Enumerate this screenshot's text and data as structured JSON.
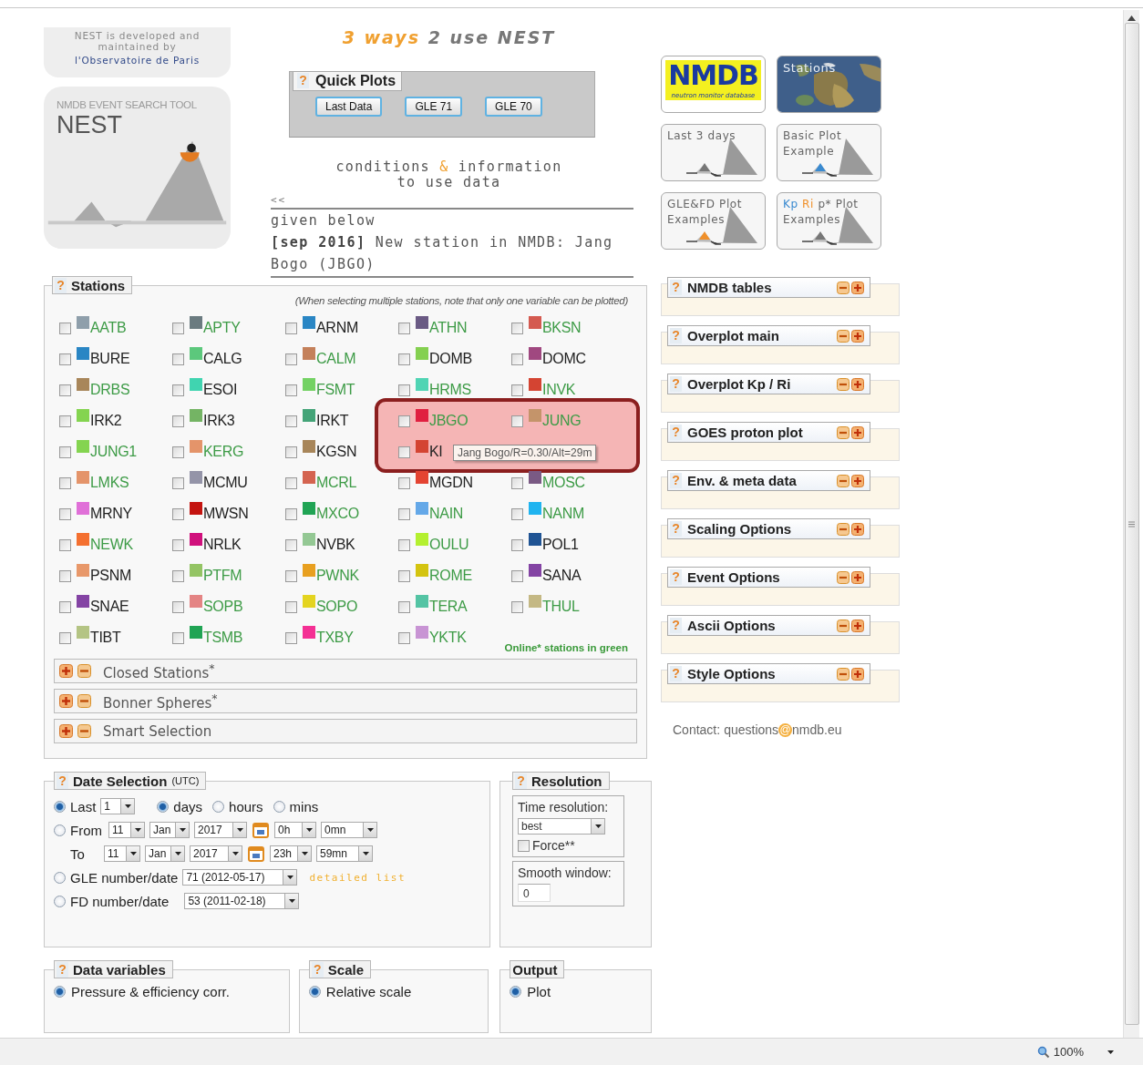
{
  "logo_card": {
    "credit_line": "NEST is developed and maintained by",
    "credit_link": "l'Observatoire de Paris",
    "subtitle": "NMDB EVENT SEARCH TOOL",
    "title": "NEST"
  },
  "headline": {
    "part_1": "3 ways",
    "part_2": "2 use NEST"
  },
  "quick_plots": {
    "help": "?",
    "title": "Quick Plots",
    "buttons": [
      "Last Data",
      "GLE 71",
      "GLE 70"
    ]
  },
  "conditions": {
    "word_1": "conditions",
    "amp": "&",
    "word_2": "information",
    "line_2": "to use data"
  },
  "news": {
    "marker": "<<",
    "lines": [
      "given below",
      "**[sep 2016]** New station in NMDB: Jang Bogo (JBGO)"
    ]
  },
  "stations": {
    "help": "?",
    "title": "Stations",
    "note": "(When selecting multiple stations, note that only one variable can be plotted)",
    "rows": [
      [
        {
          "code": "AATB",
          "color": "#8f9fab",
          "online": true,
          "checked": false
        },
        {
          "code": "APTY",
          "color": "#6b7b80",
          "online": true,
          "checked": false
        },
        {
          "code": "ARNM",
          "color": "#2a86c4",
          "online": false,
          "checked": false
        },
        {
          "code": "ATHN",
          "color": "#6a5a84",
          "online": true,
          "checked": false
        },
        {
          "code": "BKSN",
          "color": "#d45a50",
          "online": true,
          "checked": false
        }
      ],
      [
        {
          "code": "BURE",
          "color": "#2a86c4",
          "online": false,
          "checked": false
        },
        {
          "code": "CALG",
          "color": "#5cc87c",
          "online": false,
          "checked": false
        },
        {
          "code": "CALM",
          "color": "#c4805a",
          "online": true,
          "checked": false
        },
        {
          "code": "DOMB",
          "color": "#84d050",
          "online": false,
          "checked": false
        },
        {
          "code": "DOMC",
          "color": "#a04880",
          "online": false,
          "checked": false
        }
      ],
      [
        {
          "code": "DRBS",
          "color": "#a8865a",
          "online": true,
          "checked": false
        },
        {
          "code": "ESOI",
          "color": "#40d4b0",
          "online": false,
          "checked": false
        },
        {
          "code": "FSMT",
          "color": "#74d264",
          "online": true,
          "checked": false
        },
        {
          "code": "HRMS",
          "color": "#50d4b4",
          "online": true,
          "checked": false
        },
        {
          "code": "INVK",
          "color": "#d44432",
          "online": true,
          "checked": false
        }
      ],
      [
        {
          "code": "IRK2",
          "color": "#84d450",
          "online": false,
          "checked": false
        },
        {
          "code": "IRK3",
          "color": "#74b464",
          "online": false,
          "checked": false
        },
        {
          "code": "IRKT",
          "color": "#44a478",
          "online": false,
          "checked": false
        },
        {
          "code": "JBGO",
          "color": "#e02040",
          "online": true,
          "checked": false,
          "highlighted": true,
          "tooltip": "Jang Bogo/R=0.30/Alt=29m"
        },
        {
          "code": "JUNG",
          "color": "#c4946a",
          "online": true,
          "checked": false,
          "highlighted": true
        }
      ],
      [
        {
          "code": "JUNG1",
          "color": "#84d450",
          "online": true,
          "checked": false
        },
        {
          "code": "KERG",
          "color": "#e4946a",
          "online": true,
          "checked": false
        },
        {
          "code": "KGSN",
          "color": "#a8865a",
          "online": false,
          "checked": false
        },
        {
          "code": "KI",
          "color": "#d44432",
          "online": false,
          "checked": false,
          "highlighted": true
        }
      ],
      [
        {
          "code": "LMKS",
          "color": "#e4946a",
          "online": true,
          "checked": false
        },
        {
          "code": "MCMU",
          "color": "#9494a8",
          "online": false,
          "checked": false
        },
        {
          "code": "MCRL",
          "color": "#d46450",
          "online": true,
          "checked": false
        },
        {
          "code": "MGDN",
          "color": "#e44432",
          "online": false,
          "checked": false
        },
        {
          "code": "MOSC",
          "color": "#7a5a84",
          "online": true,
          "checked": false
        }
      ],
      [
        {
          "code": "MRNY",
          "color": "#e070d8",
          "online": false,
          "checked": false
        },
        {
          "code": "MWSN",
          "color": "#c41410",
          "online": false,
          "checked": false
        },
        {
          "code": "MXCO",
          "color": "#20a454",
          "online": true,
          "checked": false
        },
        {
          "code": "NAIN",
          "color": "#64a8e8",
          "online": true,
          "checked": false
        },
        {
          "code": "NANM",
          "color": "#20b4f0",
          "online": true,
          "checked": false
        }
      ],
      [
        {
          "code": "NEWK",
          "color": "#f47030",
          "online": true,
          "checked": false
        },
        {
          "code": "NRLK",
          "color": "#d0107c",
          "online": false,
          "checked": false
        },
        {
          "code": "NVBK",
          "color": "#94c894",
          "online": false,
          "checked": false
        },
        {
          "code": "OULU",
          "color": "#b4f030",
          "online": true,
          "checked": false
        },
        {
          "code": "POL1",
          "color": "#205494",
          "online": false,
          "checked": false
        }
      ],
      [
        {
          "code": "PSNM",
          "color": "#e8986a",
          "online": false,
          "checked": false
        },
        {
          "code": "PTFM",
          "color": "#94c464",
          "online": true,
          "checked": false
        },
        {
          "code": "PWNK",
          "color": "#e8a020",
          "online": true,
          "checked": false
        },
        {
          "code": "ROME",
          "color": "#d4c410",
          "online": true,
          "checked": false
        },
        {
          "code": "SANA",
          "color": "#8444a4",
          "online": false,
          "checked": false
        }
      ],
      [
        {
          "code": "SNAE",
          "color": "#8444a4",
          "online": false,
          "checked": false
        },
        {
          "code": "SOPB",
          "color": "#e48484",
          "online": true,
          "checked": false
        },
        {
          "code": "SOPO",
          "color": "#e4d420",
          "online": true,
          "checked": false
        },
        {
          "code": "TERA",
          "color": "#54c4a4",
          "online": true,
          "checked": false
        },
        {
          "code": "THUL",
          "color": "#c4b884",
          "online": true,
          "checked": false
        }
      ],
      [
        {
          "code": "TIBT",
          "color": "#b4c484",
          "online": false,
          "checked": false
        },
        {
          "code": "TSMB",
          "color": "#20a454",
          "online": true,
          "checked": false
        },
        {
          "code": "TXBY",
          "color": "#f43094",
          "online": true,
          "checked": false
        },
        {
          "code": "YKTK",
          "color": "#c894d4",
          "online": true,
          "checked": false
        }
      ]
    ],
    "online_note": "Online* stations in green",
    "groups": [
      "Closed Stations$^{*}$",
      "Bonner Spheres$^{*}$",
      "Smart Selection"
    ]
  },
  "date_selection": {
    "help": "?",
    "title": "Date Selection",
    "title_suffix": "(UTC)",
    "last": {
      "label": "Last",
      "selected": true,
      "count": "1",
      "units": [
        {
          "label": "days",
          "selected": true
        },
        {
          "label": "hours",
          "selected": false
        },
        {
          "label": "mins",
          "selected": false
        }
      ]
    },
    "from": {
      "label": "From",
      "selected": false,
      "day": "11",
      "month": "Jan",
      "year": "2017",
      "hour": "0h",
      "minute": "0mn"
    },
    "to": {
      "label": "To",
      "day": "11",
      "month": "Jan",
      "year": "2017",
      "hour": "23h",
      "minute": "59mn"
    },
    "gle": {
      "label": "GLE number/date",
      "selected": false,
      "value": "71 (2012-05-17)",
      "link": "detailed list"
    },
    "fd": {
      "label": "FD number/date",
      "selected": false,
      "value": "53 (2011-02-18)"
    }
  },
  "resolution": {
    "help": "?",
    "title": "Resolution",
    "time_label": "Time resolution:",
    "time_value": "best",
    "force_label": "Force**",
    "force_checked": false,
    "smooth_label": "Smooth window:",
    "smooth_value": "0"
  },
  "bottom_panels": [
    {
      "help": "?",
      "title": "Data variables",
      "options": [
        {
          "label": "Pressure & efficiency corr.",
          "selected": true
        }
      ]
    },
    {
      "help": "?",
      "title": "Scale",
      "options": [
        {
          "label": "Relative scale",
          "selected": true
        }
      ]
    },
    {
      "title": "Output",
      "options": [
        {
          "label": "Plot",
          "selected": true
        }
      ]
    }
  ],
  "tiles": [
    {
      "kind": "logo",
      "label": "NMDB",
      "sublabel": "neutron monitor database"
    },
    {
      "kind": "picture",
      "label": "Stations"
    },
    {
      "kind": "plot",
      "parts": [
        {
          "text": "Last 3 days"
        }
      ],
      "color": "#777777"
    },
    {
      "kind": "plot",
      "parts": [
        {
          "text": "Basic Plot"
        }
      ],
      "line_2": "Example",
      "color": "#3a8ad0"
    },
    {
      "kind": "plot",
      "parts": [
        {
          "text": "GLE&FD Plot"
        }
      ],
      "line_2": "Examples",
      "color": "#f0902a"
    },
    {
      "kind": "plot",
      "parts": [
        {
          "text": "Kp",
          "color": "#3a8ad0"
        },
        {
          "text": "Ri",
          "color": "#f0902a"
        },
        {
          "text": "p* Plot"
        }
      ],
      "line_2": "Examples",
      "color": "#777777"
    }
  ],
  "side_panels": [
    {
      "help": "?",
      "title": "NMDB tables"
    },
    {
      "help": "?",
      "title": "Overplot main"
    },
    {
      "help": "?",
      "title": "Overplot Kp / Ri"
    },
    {
      "help": "?",
      "title": "GOES proton plot"
    },
    {
      "help": "?",
      "title": "Env. & meta data"
    },
    {
      "help": "?",
      "title": "Scaling Options"
    },
    {
      "help": "?",
      "title": "Event Options"
    },
    {
      "help": "?",
      "title": "Ascii Options"
    },
    {
      "help": "?",
      "title": "Style Options"
    }
  ],
  "contact": {
    "label": "Contact:",
    "user": "questions",
    "at": "@",
    "domain": "nmdb.eu"
  },
  "status_bar": {
    "zoom": "100%"
  }
}
